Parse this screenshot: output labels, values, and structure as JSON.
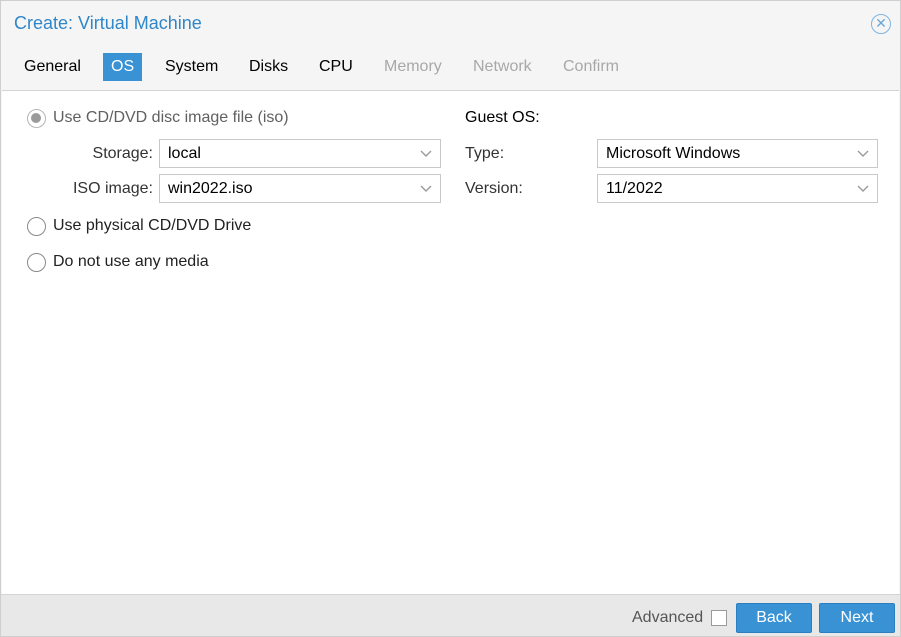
{
  "window": {
    "title": "Create: Virtual Machine",
    "close_icon": "close-circle-icon"
  },
  "tabs": [
    {
      "label": "General",
      "state": "normal"
    },
    {
      "label": "OS",
      "state": "active"
    },
    {
      "label": "System",
      "state": "normal"
    },
    {
      "label": "Disks",
      "state": "normal"
    },
    {
      "label": "CPU",
      "state": "normal"
    },
    {
      "label": "Memory",
      "state": "disabled"
    },
    {
      "label": "Network",
      "state": "disabled"
    },
    {
      "label": "Confirm",
      "state": "disabled"
    }
  ],
  "media": {
    "options": [
      {
        "label": "Use CD/DVD disc image file (iso)",
        "checked": true
      },
      {
        "label": "Use physical CD/DVD Drive",
        "checked": false
      },
      {
        "label": "Do not use any media",
        "checked": false
      }
    ],
    "storage": {
      "label": "Storage:",
      "value": "local"
    },
    "iso": {
      "label": "ISO image:",
      "value": "win2022.iso"
    }
  },
  "guest": {
    "heading": "Guest OS:",
    "type": {
      "label": "Type:",
      "value": "Microsoft Windows"
    },
    "version": {
      "label": "Version:",
      "value": "11/2022"
    }
  },
  "footer": {
    "advanced_label": "Advanced",
    "advanced_checked": false,
    "back_label": "Back",
    "next_label": "Next"
  },
  "colors": {
    "accent": "#3892d4",
    "title": "#2f86c9",
    "disabled_tab": "#a8a8a8"
  }
}
